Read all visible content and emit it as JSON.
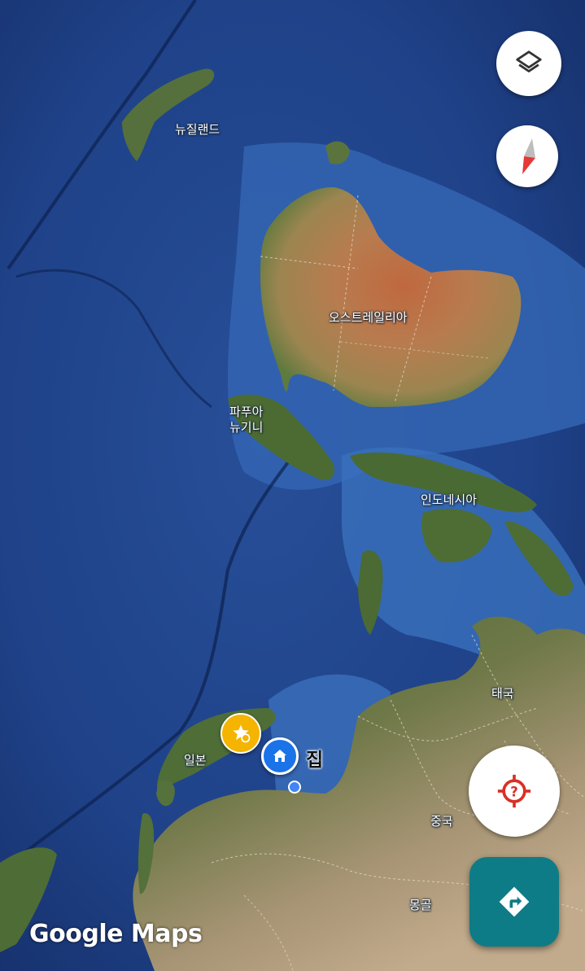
{
  "map": {
    "type": "satellite",
    "colors": {
      "ocean_deep": "#1c3c7a",
      "ocean_shallow": "#3a6bb8",
      "land_green": "#4f6f35",
      "desert": "#b98a5a",
      "red_center": "#b5643c"
    },
    "place_labels": {
      "new_zealand": "뉴질랜드",
      "australia": "오스트레일리아",
      "papua_new_guinea": "파푸아\n뉴기니",
      "indonesia": "인도네시아",
      "thailand": "태국",
      "japan": "일본",
      "china": "중국",
      "mongolia": "몽골"
    }
  },
  "markers": {
    "home_label": "집",
    "home_icon": "home-icon",
    "starred_icon": "star-place-icon",
    "location_dot_color": "#4285f4"
  },
  "controls": {
    "layers_icon": "layers-icon",
    "compass_icon": "compass-icon",
    "my_location_icon": "location-unknown-icon",
    "directions_icon": "directions-icon"
  },
  "branding": {
    "logo_text": "Google Maps"
  }
}
